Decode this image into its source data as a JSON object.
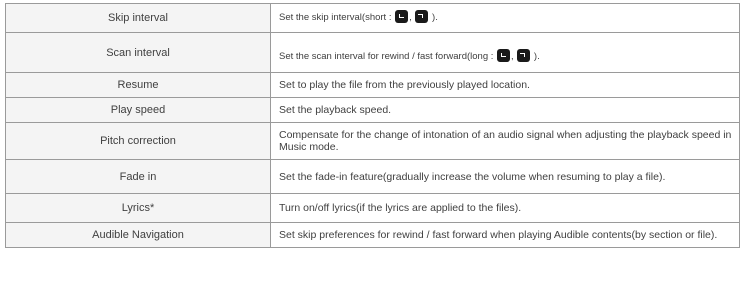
{
  "rows": [
    {
      "name": "Skip interval",
      "description_prefix": "Set the skip interval(short : ",
      "separator": ", ",
      "description_suffix": " ).",
      "icons": [
        "previous-key-icon",
        "next-key-icon"
      ]
    },
    {
      "name": "Scan interval",
      "description_prefix": "Set the scan interval for rewind / fast forward(long : ",
      "separator": ", ",
      "description_suffix": " ).",
      "icons": [
        "previous-key-icon",
        "next-key-icon"
      ]
    },
    {
      "name": "Resume",
      "description": "Set to play the file from the previously played location."
    },
    {
      "name": "Play speed",
      "description": "Set the playback speed."
    },
    {
      "name": "Pitch correction",
      "description": "Compensate for the change of intonation of an audio signal when adjusting the playback speed in Music mode."
    },
    {
      "name": "Fade in",
      "description": "Set the fade-in feature(gradually increase the volume when resuming to play a file)."
    },
    {
      "name": "Lyrics*",
      "description": "Turn on/off lyrics(if the lyrics are applied to the files)."
    },
    {
      "name": "Audible Navigation",
      "description": "Set skip preferences for rewind / fast forward when playing Audible contents(by section or file)."
    }
  ]
}
